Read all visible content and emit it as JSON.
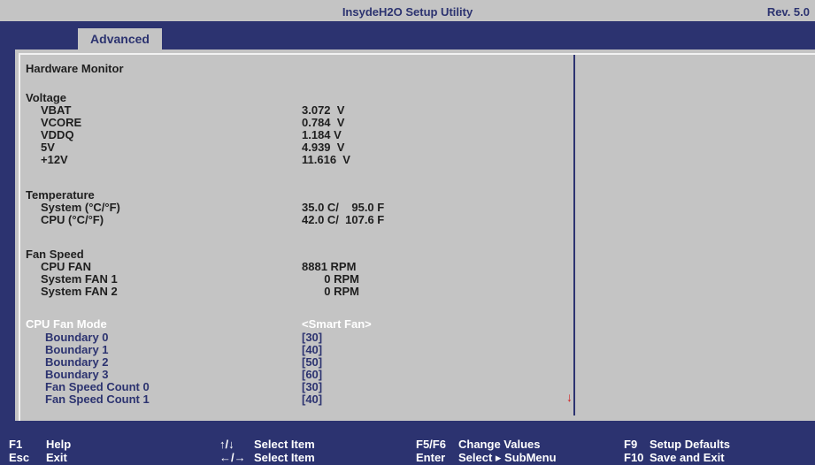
{
  "header": {
    "title": "InsydeH2O Setup Utility",
    "revision": "Rev. 5.0"
  },
  "tabs": {
    "active_label": "Advanced"
  },
  "content": {
    "section_title": "Hardware Monitor",
    "voltage": {
      "heading": "Voltage",
      "items": [
        {
          "label": "VBAT",
          "value": "3.072  V"
        },
        {
          "label": "VCORE",
          "value": "0.784  V"
        },
        {
          "label": "VDDQ",
          "value": "1.184 V"
        },
        {
          "label": "5V",
          "value": "4.939  V"
        },
        {
          "label": "+12V",
          "value": "11.616  V"
        }
      ]
    },
    "temperature": {
      "heading": "Temperature",
      "items": [
        {
          "label": "System (°C/°F)",
          "value": "35.0 C/    95.0 F"
        },
        {
          "label": "CPU (°C/°F)",
          "value": "42.0 C/  107.6 F"
        }
      ]
    },
    "fan_speed": {
      "heading": "Fan Speed",
      "items": [
        {
          "label": "CPU FAN",
          "value": "8881 RPM"
        },
        {
          "label": "System FAN 1",
          "value": "       0 RPM"
        },
        {
          "label": "System FAN 2",
          "value": "       0 RPM"
        }
      ]
    },
    "cpu_fan_mode": {
      "label": "CPU Fan Mode",
      "value": "<Smart Fan>"
    },
    "boundaries": [
      {
        "label": "Boundary 0",
        "value": "[30]"
      },
      {
        "label": "Boundary 1",
        "value": "[40]"
      },
      {
        "label": "Boundary 2",
        "value": "[50]"
      },
      {
        "label": "Boundary 3",
        "value": "[60]"
      },
      {
        "label": "Fan Speed Count 0",
        "value": "[30]"
      },
      {
        "label": "Fan Speed Count 1",
        "value": "[40]"
      }
    ],
    "scroll_arrow": "↓"
  },
  "footer": {
    "f1_key": "F1",
    "f1_desc": "Help",
    "esc_key": "Esc",
    "esc_desc": "Exit",
    "updown_key": "↑/↓",
    "updown_desc": "Select Item",
    "leftright_key": "←/→",
    "leftright_desc": "Select Item",
    "f5f6_key": "F5/F6",
    "f5f6_desc": "Change Values",
    "enter_key": "Enter",
    "enter_desc": "Select ▸ SubMenu",
    "f9_key": "F9",
    "f9_desc": "Setup Defaults",
    "f10_key": "F10",
    "f10_desc": "Save and Exit"
  },
  "colors": {
    "background_blue": "#2c3370",
    "panel_gray": "#c4c4c4",
    "highlight_white": "#ffffff",
    "scroll_arrow_red": "#d22020"
  }
}
